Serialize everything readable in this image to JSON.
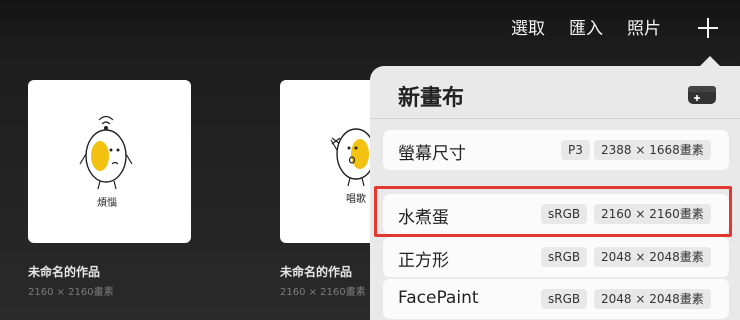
{
  "topbar": {
    "select_label": "選取",
    "import_label": "匯入",
    "photos_label": "照片",
    "add_icon": "plus-icon"
  },
  "gallery": [
    {
      "title": "未命名的作品",
      "size": "2160 × 2160畫素",
      "caption": "煩惱"
    },
    {
      "title": "未命名的作品",
      "size": "2160 × 2160畫素",
      "caption": "唱歌"
    }
  ],
  "new_canvas": {
    "title": "新畫布",
    "add_icon": "new-canvas-icon",
    "presets": [
      {
        "name": "螢幕尺寸",
        "color_profile": "P3",
        "dimensions": "2388 × 1668畫素"
      },
      {
        "name": "水煮蛋",
        "color_profile": "sRGB",
        "dimensions": "2160 × 2160畫素"
      },
      {
        "name": "正方形",
        "color_profile": "sRGB",
        "dimensions": "2048 × 2048畫素"
      },
      {
        "name": "FacePaint",
        "color_profile": "sRGB",
        "dimensions": "2048 × 2048畫素"
      }
    ]
  },
  "colors": {
    "highlight": "#e3382f",
    "egg_yolk": "#f3c10f"
  }
}
